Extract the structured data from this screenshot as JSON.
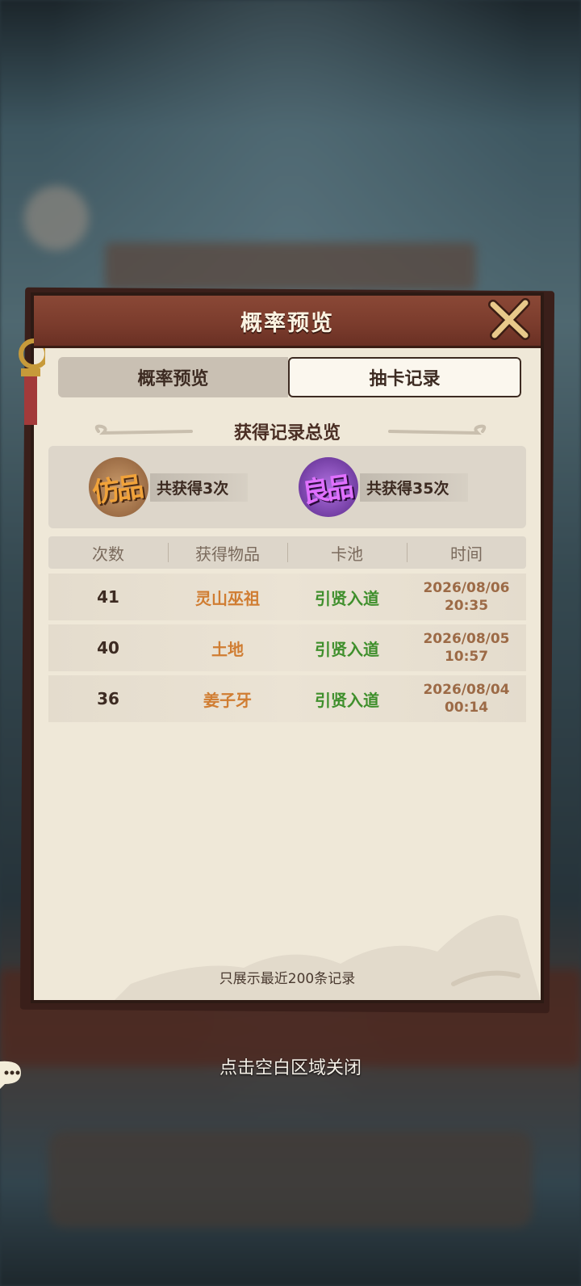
{
  "modal": {
    "title": "概率预览",
    "tabs": [
      {
        "label": "概率预览",
        "active": false
      },
      {
        "label": "抽卡记录",
        "active": true
      }
    ]
  },
  "summary": {
    "title": "获得记录总览",
    "grades": [
      {
        "badge": "仿品",
        "count_text": "共获得3次",
        "color": "#d98a2c"
      },
      {
        "badge": "良品",
        "count_text": "共获得35次",
        "color": "#8a3fc4"
      }
    ]
  },
  "table": {
    "headers": [
      "次数",
      "获得物品",
      "卡池",
      "时间"
    ],
    "rows": [
      {
        "count": "41",
        "item": "灵山巫祖",
        "pool": "引贤入道",
        "date": "2026/08/06",
        "time": "20:35"
      },
      {
        "count": "40",
        "item": "土地",
        "pool": "引贤入道",
        "date": "2026/08/05",
        "time": "10:57"
      },
      {
        "count": "36",
        "item": "姜子牙",
        "pool": "引贤入道",
        "date": "2026/08/04",
        "time": "00:14"
      }
    ]
  },
  "footnote": "只展示最近200条记录",
  "hint": "点击空白区域关闭",
  "colors": {
    "header": "#7a3b2c",
    "item_text": "#d07d32",
    "pool_text": "#3f8f2c"
  },
  "icons": {
    "close": "close-x-icon",
    "chat": "chat-bubble-icon"
  }
}
